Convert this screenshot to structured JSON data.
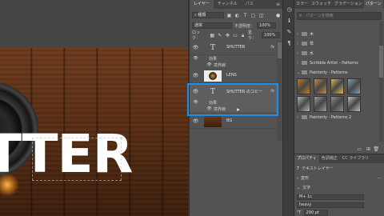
{
  "canvas": {
    "text": "TTER"
  },
  "layers_panel": {
    "tabs": [
      "レイヤー",
      "チャンネル",
      "パス"
    ],
    "active_tab": 0,
    "kind_label": "種類",
    "blend_mode": "通常",
    "opacity_label": "不透明度：",
    "opacity_value": "100%",
    "lock_label": "ロック：",
    "fill_label": "塗り：",
    "fill_value": "100%",
    "layers": [
      {
        "name": "SHUTTER",
        "type": "text",
        "fx": "fx",
        "effects_label": "効果",
        "effect": "境界線"
      },
      {
        "name": "LENS",
        "type": "image"
      },
      {
        "name": "SHUTTER のコピー",
        "type": "text",
        "fx": "fx",
        "effects_label": "効果",
        "effect": "境界線",
        "selected": true
      },
      {
        "name": "BG",
        "type": "image"
      }
    ]
  },
  "patterns_panel": {
    "tabs": [
      "カラー",
      "スウォッチ",
      "グラデーション",
      "パターン"
    ],
    "active_tab": 3,
    "search_placeholder": "パターンを検索",
    "folders": [
      "木",
      "草",
      "水",
      "Scribble Artist - Patterns",
      "Painterly - Patterns"
    ],
    "bottom_folder": "Painterly - Patterns 2",
    "swatch_colors": [
      "#c97a1e",
      "#c98a3a",
      "#d8b85a",
      "#7f9fb8",
      "#b3b3b3",
      "#9a9a9a",
      "#8d8d8d",
      "#bdbdbd",
      "#a8a8a8"
    ]
  },
  "properties_panel": {
    "tabs": [
      "プロパティ",
      "色調補正",
      "CC ライブラリ"
    ],
    "active_tab": 0,
    "layer_type": "テキストレイヤー",
    "transform_label": "変形",
    "text_section": "文字",
    "font_name": "M+ 1c",
    "font_style": "heavy",
    "font_size": "290 pt"
  },
  "colors": {
    "accent": "#1e8fe8",
    "panel_bg": "#535353",
    "tab_bg": "#424242"
  }
}
